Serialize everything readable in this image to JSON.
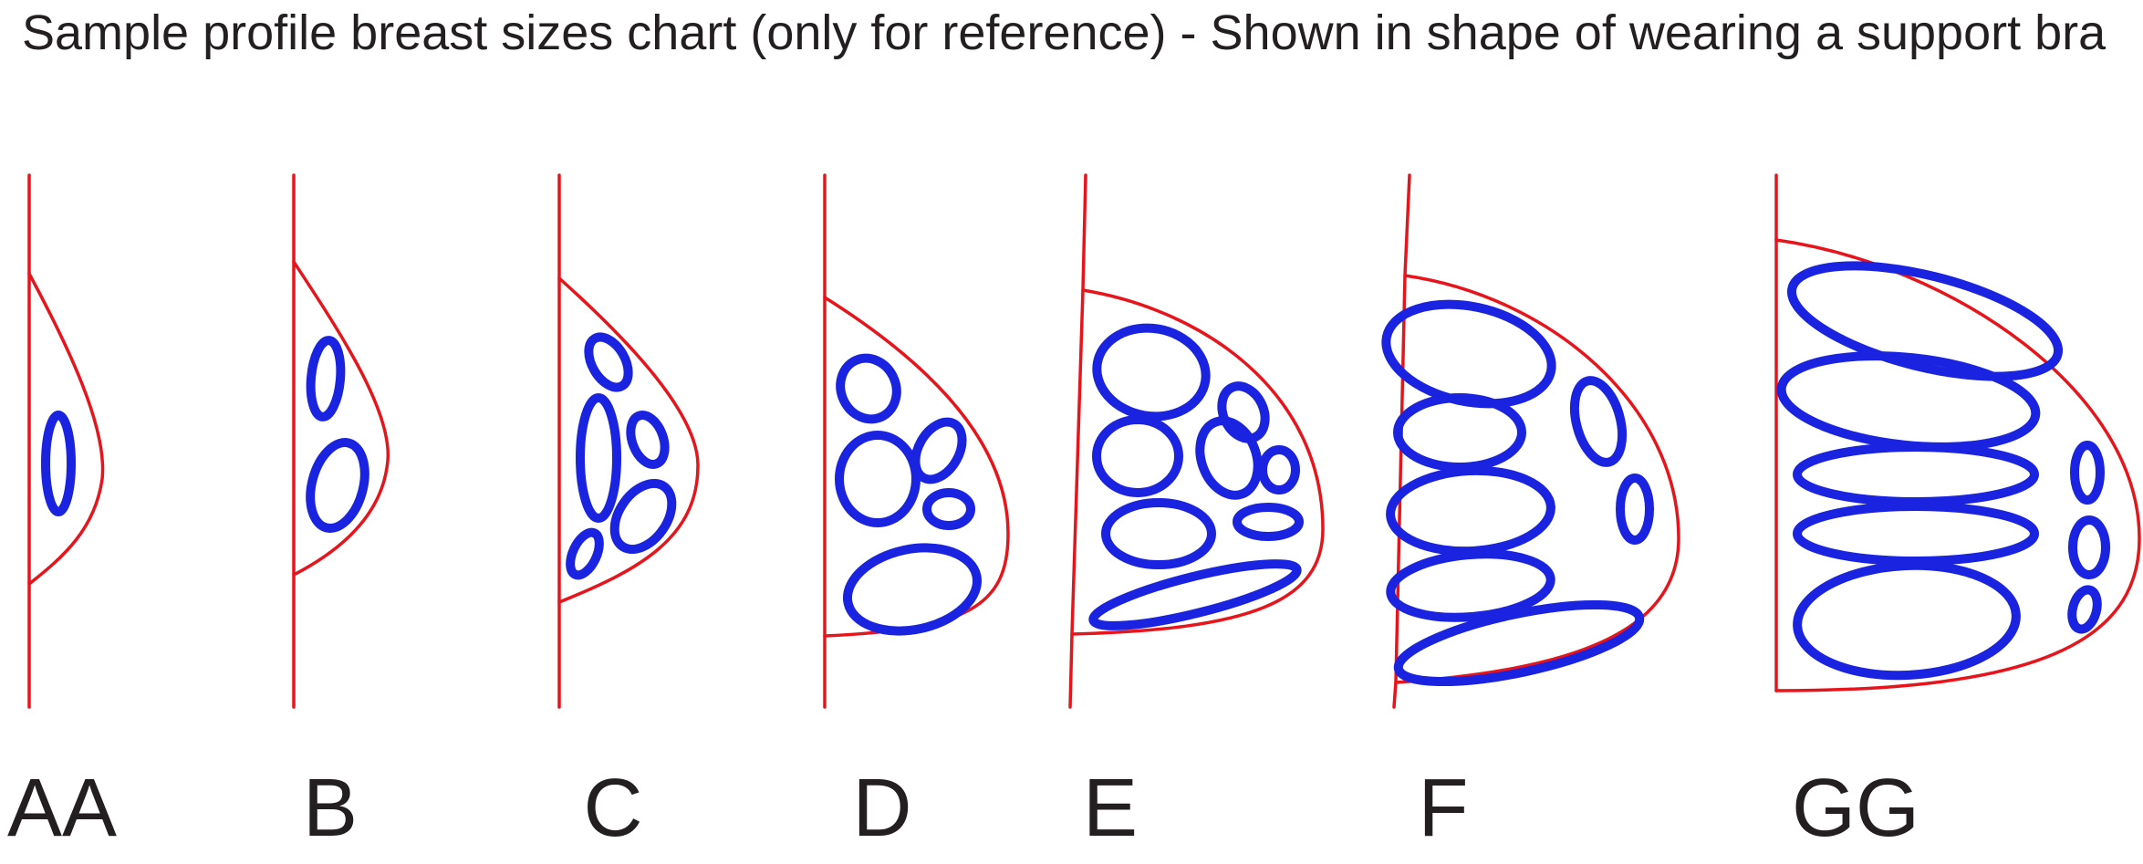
{
  "title": "Sample profile breast sizes chart (only for reference) - Shown in shape of wearing a support bra",
  "colors": {
    "outline": "#e8141b",
    "tissue": "#1a23e0",
    "text": "#231f20",
    "background": "#ffffff"
  },
  "profiles": [
    {
      "label": "AA"
    },
    {
      "label": "B"
    },
    {
      "label": "C"
    },
    {
      "label": "D"
    },
    {
      "label": "E"
    },
    {
      "label": "F"
    },
    {
      "label": "GG"
    }
  ]
}
